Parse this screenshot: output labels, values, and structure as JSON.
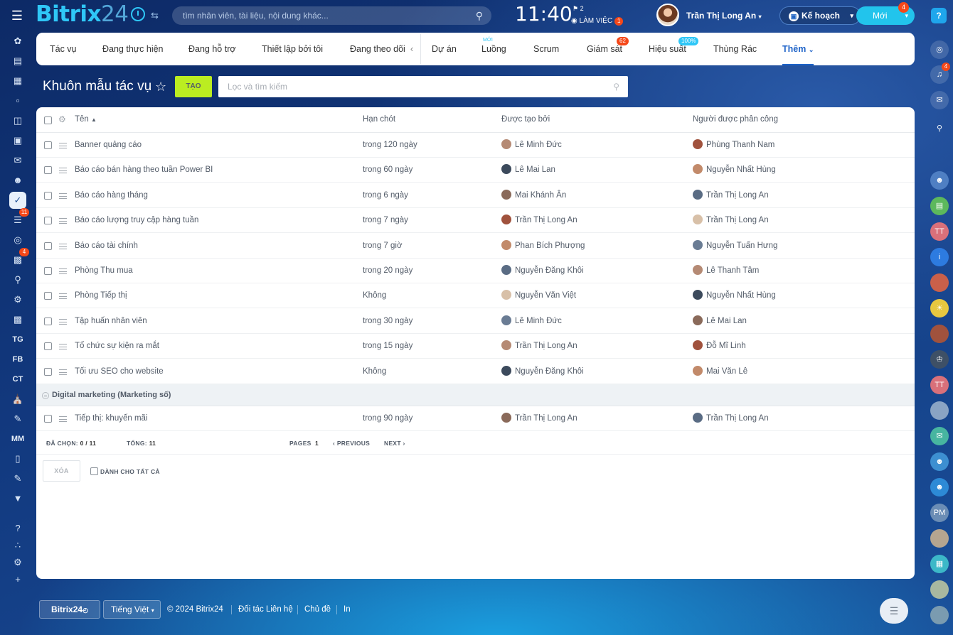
{
  "app": {
    "logo_main": "Bitrix",
    "logo_num": "24"
  },
  "topbar": {
    "search_placeholder": "tìm nhân viên, tài liệu, nội dung khác...",
    "time": "11:40",
    "flag_count": "2",
    "work_status": "LÀM VIỆC",
    "work_badge": "1",
    "user_name": "Trần Thị Long An",
    "plan_label": "Kế hoạch",
    "new_label": "Mới",
    "new_badge": "4",
    "help": "?"
  },
  "nav": {
    "tabs": [
      {
        "label": "Tác vụ"
      },
      {
        "label": "Đang thực hiện"
      },
      {
        "label": "Đang hỗ trợ"
      },
      {
        "label": "Thiết lập bởi tôi"
      },
      {
        "label": "Đang theo dõi"
      },
      {
        "label": "Dự án"
      },
      {
        "label": "Luồng",
        "sup": "MỚI"
      },
      {
        "label": "Scrum"
      },
      {
        "label": "Giám sát",
        "badge": "62"
      },
      {
        "label": "Hiệu suất",
        "badge": "100%"
      },
      {
        "label": "Thùng Rác"
      },
      {
        "label": "Thêm"
      }
    ]
  },
  "page": {
    "title": "Khuôn mẫu tác vụ",
    "create_label": "TẠO",
    "filter_placeholder": "Lọc và tìm kiếm"
  },
  "table": {
    "headers": {
      "name": "Tên",
      "deadline": "Hạn chót",
      "created_by": "Được tạo bởi",
      "assignee": "Người được phân công"
    },
    "rows": [
      {
        "name": "Banner quảng cáo",
        "deadline": "trong 120 ngày",
        "created_by": "Lê Minh Đức",
        "assignee": "Phùng Thanh Nam"
      },
      {
        "name": "Báo cáo bán hàng theo tuần Power BI",
        "deadline": "trong 60 ngày",
        "created_by": "Lê Mai Lan",
        "assignee": "Nguyễn Nhất Hùng"
      },
      {
        "name": "Báo cáo hàng tháng",
        "deadline": "trong 6 ngày",
        "created_by": "Mai Khánh Ân",
        "assignee": "Trần Thị Long An"
      },
      {
        "name": "Báo cáo lượng truy cập hàng tuần",
        "deadline": "trong 7 ngày",
        "created_by": "Trần Thị Long An",
        "assignee": "Trần Thị Long An"
      },
      {
        "name": "Báo cáo tài chính",
        "deadline": "trong 7 giờ",
        "created_by": "Phan Bích Phượng",
        "assignee": "Nguyễn Tuấn Hưng"
      },
      {
        "name": "Phòng Thu mua",
        "deadline": "trong 20 ngày",
        "created_by": "Nguyễn Đăng Khôi",
        "assignee": "Lê Thanh Tâm"
      },
      {
        "name": "Phòng Tiếp thị",
        "deadline": "Không",
        "created_by": "Nguyễn Văn Việt",
        "assignee": "Nguyễn Nhất Hùng"
      },
      {
        "name": "Tập huấn nhân viên",
        "deadline": "trong 30 ngày",
        "created_by": "Lê Minh Đức",
        "assignee": "Lê Mai Lan"
      },
      {
        "name": "Tổ chức sự kiện ra mắt",
        "deadline": "trong 15 ngày",
        "created_by": "Trần Thị Long An",
        "assignee": "Đỗ Mĩ Linh"
      },
      {
        "name": "Tối ưu SEO cho website",
        "deadline": "Không",
        "created_by": "Nguyễn Đăng Khôi",
        "assignee": "Mai Văn Lê"
      }
    ],
    "group": {
      "label": "Digital marketing (Marketing số)",
      "rows": [
        {
          "name": "Tiếp thị: khuyến mãi",
          "deadline": "trong 90 ngày",
          "created_by": "Trần Thị Long An",
          "assignee": "Trần Thị Long An"
        }
      ]
    },
    "footer": {
      "selected_label": "ĐÃ CHỌN:",
      "selected_value": "0 / 11",
      "total_label": "TỔNG:",
      "total_value": "11",
      "pages_label": "PAGES",
      "page_value": "1",
      "previous": "PREVIOUS",
      "next": "NEXT",
      "delete_label": "XÓA",
      "for_all_label": "DÀNH CHO TẤT CẢ"
    }
  },
  "sidebar_left": {
    "items": [
      "TG",
      "FB",
      "CT",
      "MM"
    ],
    "badges": [
      "11",
      "4"
    ]
  },
  "sidebar_right": {
    "items": [
      "TT",
      "TT",
      "PM"
    ],
    "badge": "4"
  },
  "footer": {
    "logo": "Bitrix24",
    "language": "Tiếng Việt",
    "copyright": "© 2024 Bitrix24",
    "partner": "Đối tác Liên hệ",
    "theme": "Chủ đề",
    "print": "In"
  },
  "colors": {
    "accent": "#1e63c8",
    "create_button": "#bbed21",
    "badge": "#f54819",
    "logo": "#2fc7f7"
  }
}
